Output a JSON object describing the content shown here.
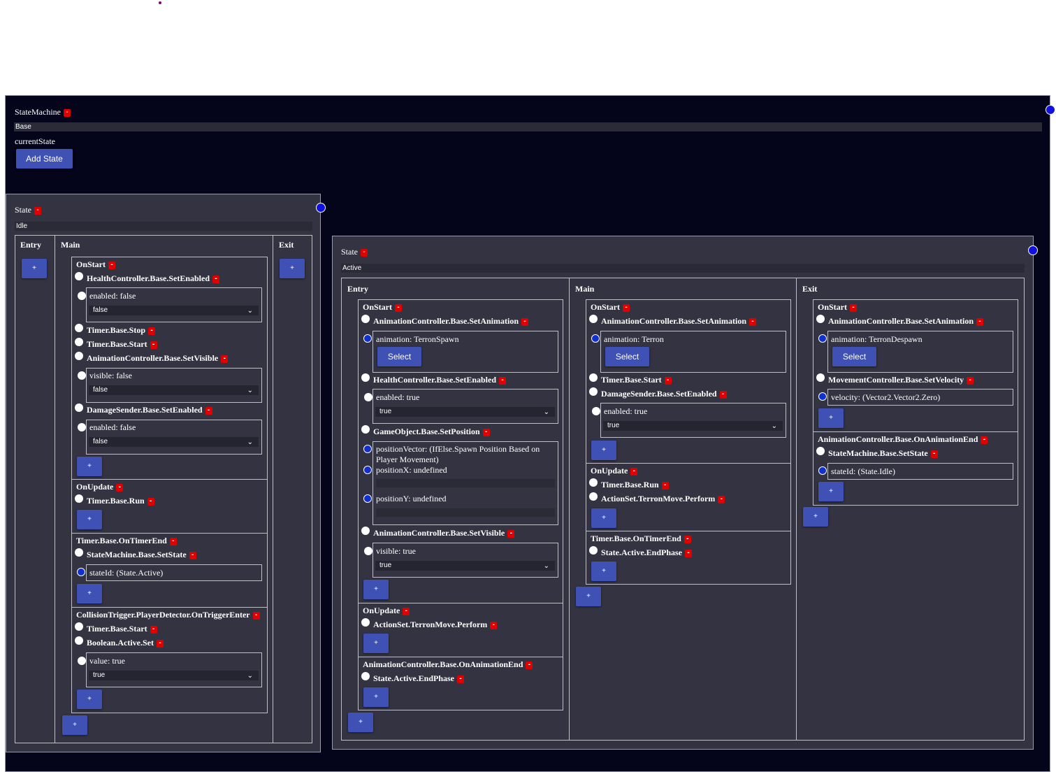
{
  "machine": {
    "title": "StateMachine",
    "name_value": "Base",
    "current_state_label": "currentState",
    "add_state_label": "Add State"
  },
  "common": {
    "minus": "-",
    "plus": "+",
    "select": "Select",
    "chevron": "⌄"
  },
  "idle": {
    "title": "State",
    "name_value": "Idle",
    "col_entry": "Entry",
    "col_main": "Main",
    "col_exit": "Exit",
    "onstart": {
      "title": "OnStart",
      "a1": "HealthController.Base.SetEnabled",
      "a1_param": "enabled: false",
      "a1_select": "false",
      "a2": "Timer.Base.Stop",
      "a3": "Timer.Base.Start",
      "a4": "AnimationController.Base.SetVisible",
      "a4_param": "visible: false",
      "a4_select": "false",
      "a5": "DamageSender.Base.SetEnabled",
      "a5_param": "enabled: false",
      "a5_select": "false"
    },
    "onupdate": {
      "title": "OnUpdate",
      "a1": "Timer.Base.Run"
    },
    "ontimer": {
      "title": "Timer.Base.OnTimerEnd",
      "a1": "StateMachine.Base.SetState",
      "a1_param": "stateId: (State.Active)"
    },
    "ontrigger": {
      "title": "CollisionTrigger.PlayerDetector.OnTriggerEnter",
      "a1": "Timer.Base.Start",
      "a2": "Boolean.Active.Set",
      "a2_param": "value: true",
      "a2_select": "true"
    }
  },
  "active": {
    "title": "State",
    "name_value": "Active",
    "col_entry": "Entry",
    "col_main": "Main",
    "col_exit": "Exit",
    "entry": {
      "onstart": {
        "title": "OnStart",
        "a1": "AnimationController.Base.SetAnimation",
        "a1_param": "animation: TerronSpawn",
        "a2": "HealthController.Base.SetEnabled",
        "a2_param": "enabled: true",
        "a2_select": "true",
        "a3": "GameObject.Base.SetPosition",
        "a3_p1": "positionVector: (IfElse.Spawn Position Based on Player Movement)",
        "a3_p2": "positionX: undefined",
        "a3_p3": "positionY: undefined",
        "a4": "AnimationController.Base.SetVisible",
        "a4_param": "visible: true",
        "a4_select": "true"
      },
      "onupdate": {
        "title": "OnUpdate",
        "a1": "ActionSet.TerronMove.Perform"
      },
      "onanimend": {
        "title": "AnimationController.Base.OnAnimationEnd",
        "a1": "State.Active.EndPhase"
      }
    },
    "main": {
      "onstart": {
        "title": "OnStart",
        "a1": "AnimationController.Base.SetAnimation",
        "a1_param": "animation: Terron",
        "a2": "Timer.Base.Start",
        "a3": "DamageSender.Base.SetEnabled",
        "a3_param": "enabled: true",
        "a3_select": "true"
      },
      "onupdate": {
        "title": "OnUpdate",
        "a1": "Timer.Base.Run",
        "a2": "ActionSet.TerronMove.Perform"
      },
      "ontimer": {
        "title": "Timer.Base.OnTimerEnd",
        "a1": "State.Active.EndPhase"
      }
    },
    "exit": {
      "onstart": {
        "title": "OnStart",
        "a1": "AnimationController.Base.SetAnimation",
        "a1_param": "animation: TerronDespawn",
        "a2": "MovementController.Base.SetVelocity",
        "a2_param": "velocity: (Vector2.Vector2.Zero)"
      },
      "onanimend": {
        "title": "AnimationController.Base.OnAnimationEnd",
        "a1": "StateMachine.Base.SetState",
        "a1_param": "stateId: (State.Idle)"
      }
    }
  }
}
